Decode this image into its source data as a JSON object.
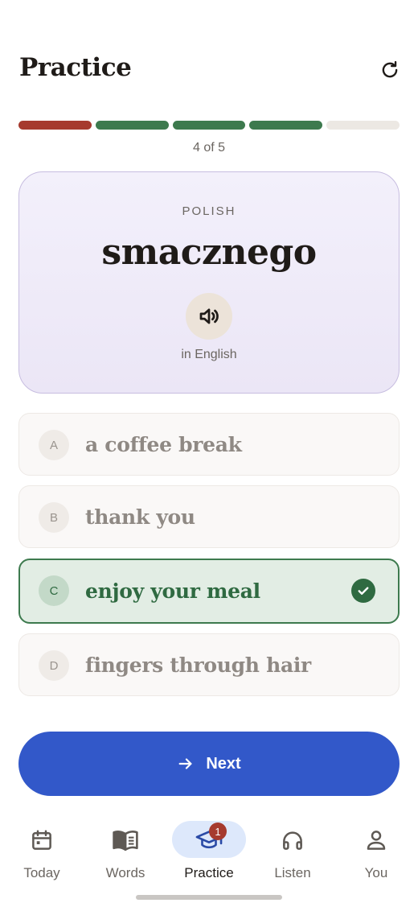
{
  "header": {
    "title": "Practice",
    "reset_icon": "refresh-icon"
  },
  "progress": {
    "text": "4 of 5",
    "segments": [
      {
        "state": "wrong",
        "color": "#a63a2e"
      },
      {
        "state": "correct",
        "color": "#3d7a4e"
      },
      {
        "state": "correct",
        "color": "#3d7a4e"
      },
      {
        "state": "correct",
        "color": "#3d7a4e"
      },
      {
        "state": "pending",
        "color": "#ece8e3"
      }
    ]
  },
  "card": {
    "language": "POLISH",
    "word": "smacznego",
    "audio_icon": "speaker-icon",
    "hint": "in English"
  },
  "options": [
    {
      "letter": "A",
      "text": "a coffee break",
      "state": "dimmed"
    },
    {
      "letter": "B",
      "text": "thank you",
      "state": "dimmed"
    },
    {
      "letter": "C",
      "text": "enjoy your meal",
      "state": "correct"
    },
    {
      "letter": "D",
      "text": "fingers through hair",
      "state": "dimmed"
    }
  ],
  "next_button": {
    "label": "Next",
    "icon": "arrow-right-icon"
  },
  "nav": {
    "items": [
      {
        "label": "Today",
        "icon": "calendar-icon"
      },
      {
        "label": "Words",
        "icon": "book-icon"
      },
      {
        "label": "Practice",
        "icon": "graduation-cap-icon",
        "badge": "1",
        "active": true
      },
      {
        "label": "Listen",
        "icon": "headphones-icon"
      },
      {
        "label": "You",
        "icon": "person-icon"
      }
    ]
  },
  "colors": {
    "accent": "#3258c9",
    "correct": "#2f6a41",
    "wrong": "#a63a2e",
    "card_bg": "#efebf9"
  }
}
